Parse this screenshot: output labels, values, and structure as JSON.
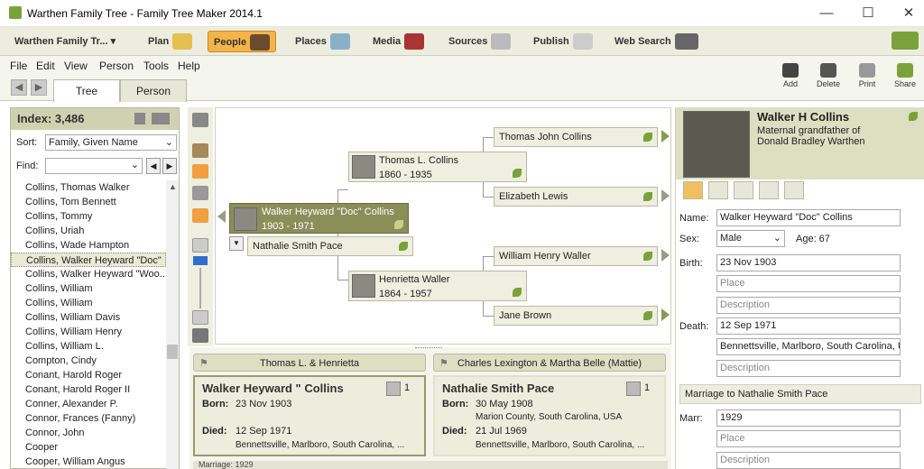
{
  "window": {
    "title": "Warthen Family Tree - Family Tree Maker 2014.1",
    "minimize": "—",
    "maximize": "☐",
    "close": "✕"
  },
  "ribbon": {
    "tree_dropdown": "Warthen Family Tr... ▾",
    "tabs": [
      "Plan",
      "People",
      "Places",
      "Media",
      "Sources",
      "Publish",
      "Web Search"
    ],
    "active": "People"
  },
  "menu": [
    "File",
    "Edit",
    "View",
    "Person",
    "Tools",
    "Help"
  ],
  "toolbar": {
    "tree_tab": "Tree",
    "person_tab": "Person",
    "add": "Add",
    "delete": "Delete",
    "print": "Print",
    "share": "Share"
  },
  "index": {
    "title": "Index: 3,486",
    "sort_label": "Sort:",
    "sort_value": "Family, Given Name",
    "find_label": "Find:",
    "items": [
      "Collins, Thomas Walker",
      "Collins, Tom Bennett",
      "Collins, Tommy",
      "Collins, Uriah",
      "Collins, Wade Hampton",
      "Collins, Walker Heyward \"Doc\"",
      "Collins, Walker Heyward \"Woo...",
      "Collins, William",
      "Collins, William",
      "Collins, William Davis",
      "Collins, William Henry",
      "Collins, William L.",
      "Compton, Cindy",
      "Conant, Harold Roger",
      "Conant, Harold Roger II",
      "Conner, Alexander P.",
      "Connor, Frances (Fanny)",
      "Connor, John",
      "Cooper",
      "Cooper, William Angus"
    ],
    "selected_index": 5
  },
  "tree": {
    "root": {
      "name": "Walker Heyward \"Doc\" Collins",
      "dates": "1903 - 1971"
    },
    "spouse": "Nathalie Smith Pace",
    "father": {
      "name": "Thomas L. Collins",
      "dates": "1860 - 1935"
    },
    "mother": {
      "name": "Henrietta Waller",
      "dates": "1864 - 1957"
    },
    "pgf": "Thomas John Collins",
    "pgm": "Elizabeth Lewis",
    "mgf": "William Henry Waller",
    "mgm": "Jane Brown"
  },
  "bottom": {
    "parents_tab1": "Thomas L. & Henrietta",
    "parents_tab2": "Charles Lexington & Martha Belle (Mattie)",
    "card1": {
      "name": "Walker Heyward \" Collins",
      "count": "1",
      "born_label": "Born:",
      "born": "23 Nov 1903",
      "died_label": "Died:",
      "died": "12 Sep 1971",
      "died_place": "Bennettsville, Marlboro, South Carolina, ..."
    },
    "card2": {
      "name": "Nathalie Smith Pace",
      "count": "1",
      "born_label": "Born:",
      "born": "30 May 1908",
      "born_place": "Marion County, South Carolina, USA",
      "died_label": "Died:",
      "died": "21 Jul 1969",
      "died_place": "Bennettsville, Marlboro, South Carolina, ..."
    },
    "marriage": "Marriage: 1929"
  },
  "right": {
    "name": "Walker H Collins",
    "relation1": "Maternal grandfather of",
    "relation2": "Donald Bradley Warthen",
    "name_label": "Name:",
    "name_value": "Walker Heyward \"Doc\" Collins",
    "sex_label": "Sex:",
    "sex_value": "Male",
    "age": "Age: 67",
    "birth_label": "Birth:",
    "birth_date": "23 Nov 1903",
    "place_ph": "Place",
    "desc_ph": "Description",
    "death_label": "Death:",
    "death_date": "12 Sep 1971",
    "death_place": "Bennettsville, Marlboro, South Carolina, USA",
    "marriage_header": "Marriage to Nathalie Smith Pace",
    "marr_label": "Marr:",
    "marr_date": "1929"
  }
}
